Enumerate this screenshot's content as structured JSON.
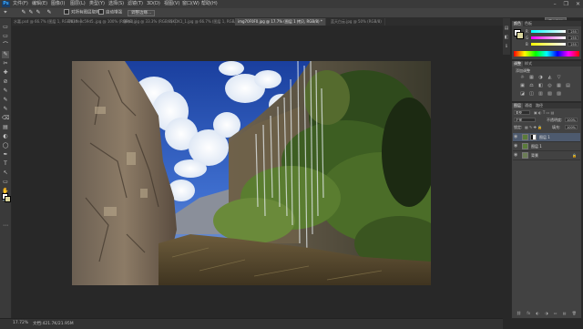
{
  "app": {
    "logo": "Ps",
    "window_controls": [
      "–",
      "❐",
      "✕"
    ],
    "workspace_button": "基本功能"
  },
  "menu": [
    "文件(F)",
    "编辑(E)",
    "图像(I)",
    "图层(L)",
    "类型(Y)",
    "选择(S)",
    "滤镜(T)",
    "3D(D)",
    "视图(V)",
    "窗口(W)",
    "帮助(H)"
  ],
  "options_bar": {
    "tool_mode_icons": [
      "✎",
      "✎",
      "✎",
      "✎"
    ],
    "sample_all_layers": "对所有图层取样",
    "auto_enhance": "自动增强",
    "refine_edge": "调整边缘..."
  },
  "tabs": [
    {
      "label": "水嘉.psd @ 66.7% (图层 1, RGB/8) *",
      "active": false
    },
    {
      "label": "7b38e8c59d5..jpg @ 100% (RGB/8)",
      "active": false
    },
    {
      "label": "瀑布1.jpg @ 33.3% (RGB/8)",
      "active": false
    },
    {
      "label": "SKDK1_1.jpg @ 66.7% (图层 1, RGB/8) *",
      "active": false
    },
    {
      "label": "img70F0F0.jpg @ 17.7% (图层 1 拷贝, RGB/8) *",
      "active": true
    },
    {
      "label": "蓝天白云.jpg @ 50% (RGB/8)",
      "active": false
    }
  ],
  "tools": [
    "▭",
    "▭",
    "⌒",
    "✎",
    "✂",
    "✚",
    "⊘",
    "✎",
    "✎",
    "✎",
    "⌫",
    "▤",
    "◐",
    "◯",
    "✒",
    "T",
    "↖",
    "▭",
    "✋",
    "🔍",
    "⋯"
  ],
  "colors": {
    "foreground": "#ffffff",
    "background": "#d9d59c"
  },
  "status": {
    "zoom": "17.72%",
    "doc": "文档:421.7K/21.95M"
  },
  "color_panel": {
    "tabs": [
      "颜色",
      "色板"
    ],
    "channels": [
      {
        "label": "R",
        "value": "255"
      },
      {
        "label": "G",
        "value": "255"
      },
      {
        "label": "B",
        "value": "255"
      }
    ]
  },
  "adjustments_panel": {
    "tabs": [
      "调整",
      "样式"
    ],
    "title": "添加调整",
    "row1_icons": [
      "☼",
      "▦",
      "◑",
      "◭",
      "▽"
    ],
    "row2_icons": [
      "▣",
      "⚖",
      "◧",
      "◎",
      "▦",
      "▤"
    ],
    "row3_icons": [
      "◪",
      "◫",
      "▥",
      "▧",
      "▨"
    ]
  },
  "layers_panel": {
    "tabs": [
      "图层",
      "通道",
      "路径"
    ],
    "kind_filter": "类型",
    "blend_mode": "正常",
    "opacity_label": "不透明度:",
    "opacity_value": "100%",
    "lock_label": "锁定:",
    "fill_label": "填充:",
    "fill_value": "100%",
    "layers": [
      {
        "name": "图层 1",
        "active": true,
        "has_mask": true,
        "locked": false
      },
      {
        "name": "图层 1",
        "active": false,
        "has_mask": false,
        "locked": false
      },
      {
        "name": "背景",
        "active": false,
        "has_mask": false,
        "locked": true
      }
    ],
    "footer_icons": [
      "⛓",
      "fx",
      "◐",
      "◑",
      "▭",
      "▤",
      "🗑"
    ]
  }
}
